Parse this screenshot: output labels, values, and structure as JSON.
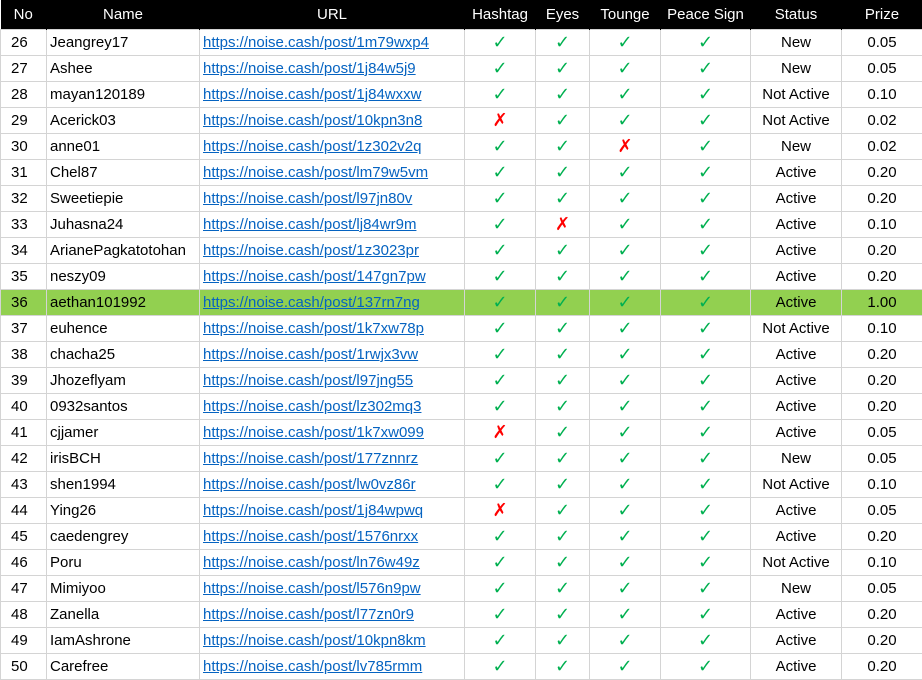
{
  "colors": {
    "header_bg": "#000000",
    "header_text": "#ffffff",
    "link": "#0563c1",
    "check": "#00b050",
    "cross": "#ff0000",
    "highlight": "#92d050"
  },
  "icons": {
    "yes": "check-icon",
    "no": "cross-icon"
  },
  "headers": [
    "No",
    "Name",
    "URL",
    "Hashtag",
    "Eyes",
    "Tounge",
    "Peace Sign",
    "Status",
    "Prize"
  ],
  "rows": [
    {
      "no": "26",
      "name": "Jeangrey17",
      "url": "https://noise.cash/post/1m79wxp4",
      "hashtag": true,
      "eyes": true,
      "tounge": true,
      "peace": true,
      "status": "New",
      "prize": "0.05"
    },
    {
      "no": "27",
      "name": "Ashee",
      "url": "https://noise.cash/post/1j84w5j9",
      "hashtag": true,
      "eyes": true,
      "tounge": true,
      "peace": true,
      "status": "New",
      "prize": "0.05"
    },
    {
      "no": "28",
      "name": "mayan120189",
      "url": "https://noise.cash/post/1j84wxxw",
      "hashtag": true,
      "eyes": true,
      "tounge": true,
      "peace": true,
      "status": "Not Active",
      "prize": "0.10"
    },
    {
      "no": "29",
      "name": "Acerick03",
      "url": "https://noise.cash/post/10kpn3n8",
      "hashtag": false,
      "eyes": true,
      "tounge": true,
      "peace": true,
      "status": "Not Active",
      "prize": "0.02"
    },
    {
      "no": "30",
      "name": "anne01",
      "url": "https://noise.cash/post/1z302v2q",
      "hashtag": true,
      "eyes": true,
      "tounge": false,
      "peace": true,
      "status": "New",
      "prize": "0.02"
    },
    {
      "no": "31",
      "name": "Chel87",
      "url": "https://noise.cash/post/lm79w5vm",
      "hashtag": true,
      "eyes": true,
      "tounge": true,
      "peace": true,
      "status": "Active",
      "prize": "0.20"
    },
    {
      "no": "32",
      "name": "Sweetiepie",
      "url": "https://noise.cash/post/l97jn80v",
      "hashtag": true,
      "eyes": true,
      "tounge": true,
      "peace": true,
      "status": "Active",
      "prize": "0.20"
    },
    {
      "no": "33",
      "name": "Juhasna24",
      "url": "https://noise.cash/post/lj84wr9m",
      "hashtag": true,
      "eyes": false,
      "tounge": true,
      "peace": true,
      "status": "Active",
      "prize": "0.10"
    },
    {
      "no": "34",
      "name": "ArianePagkatotohan",
      "url": "https://noise.cash/post/1z3023pr",
      "hashtag": true,
      "eyes": true,
      "tounge": true,
      "peace": true,
      "status": "Active",
      "prize": "0.20"
    },
    {
      "no": "35",
      "name": "neszy09",
      "url": "https://noise.cash/post/147gn7pw",
      "hashtag": true,
      "eyes": true,
      "tounge": true,
      "peace": true,
      "status": "Active",
      "prize": "0.20"
    },
    {
      "no": "36",
      "name": "aethan101992",
      "url": "https://noise.cash/post/137rn7ng",
      "hashtag": true,
      "eyes": true,
      "tounge": true,
      "peace": true,
      "status": "Active",
      "prize": "1.00",
      "highlight": true
    },
    {
      "no": "37",
      "name": "euhence",
      "url": "https://noise.cash/post/1k7xw78p",
      "hashtag": true,
      "eyes": true,
      "tounge": true,
      "peace": true,
      "status": "Not Active",
      "prize": "0.10"
    },
    {
      "no": "38",
      "name": "chacha25",
      "url": "https://noise.cash/post/1rwjx3vw",
      "hashtag": true,
      "eyes": true,
      "tounge": true,
      "peace": true,
      "status": "Active",
      "prize": "0.20"
    },
    {
      "no": "39",
      "name": "Jhozeflyam",
      "url": "https://noise.cash/post/l97jng55",
      "hashtag": true,
      "eyes": true,
      "tounge": true,
      "peace": true,
      "status": "Active",
      "prize": "0.20"
    },
    {
      "no": "40",
      "name": "0932santos",
      "url": "https://noise.cash/post/lz302mq3",
      "hashtag": true,
      "eyes": true,
      "tounge": true,
      "peace": true,
      "status": "Active",
      "prize": "0.20"
    },
    {
      "no": "41",
      "name": "cjjamer",
      "url": "https://noise.cash/post/1k7xw099",
      "hashtag": false,
      "eyes": true,
      "tounge": true,
      "peace": true,
      "status": "Active",
      "prize": "0.05"
    },
    {
      "no": "42",
      "name": "irisBCH",
      "url": "https://noise.cash/post/177znnrz",
      "hashtag": true,
      "eyes": true,
      "tounge": true,
      "peace": true,
      "status": "New",
      "prize": "0.05"
    },
    {
      "no": "43",
      "name": "shen1994",
      "url": "https://noise.cash/post/lw0vz86r",
      "hashtag": true,
      "eyes": true,
      "tounge": true,
      "peace": true,
      "status": "Not Active",
      "prize": "0.10"
    },
    {
      "no": "44",
      "name": "Ying26",
      "url": "https://noise.cash/post/1j84wpwq",
      "hashtag": false,
      "eyes": true,
      "tounge": true,
      "peace": true,
      "status": "Active",
      "prize": "0.05"
    },
    {
      "no": "45",
      "name": "caedengrey",
      "url": "https://noise.cash/post/1576nrxx",
      "hashtag": true,
      "eyes": true,
      "tounge": true,
      "peace": true,
      "status": "Active",
      "prize": "0.20"
    },
    {
      "no": "46",
      "name": "Poru",
      "url": "https://noise.cash/post/ln76w49z",
      "hashtag": true,
      "eyes": true,
      "tounge": true,
      "peace": true,
      "status": "Not Active",
      "prize": "0.10"
    },
    {
      "no": "47",
      "name": "Mimiyoo",
      "url": "https://noise.cash/post/l576n9pw",
      "hashtag": true,
      "eyes": true,
      "tounge": true,
      "peace": true,
      "status": "New",
      "prize": "0.05"
    },
    {
      "no": "48",
      "name": "Zanella",
      "url": "https://noise.cash/post/l77zn0r9",
      "hashtag": true,
      "eyes": true,
      "tounge": true,
      "peace": true,
      "status": "Active",
      "prize": "0.20"
    },
    {
      "no": "49",
      "name": "IamAshrone",
      "url": "https://noise.cash/post/10kpn8km",
      "hashtag": true,
      "eyes": true,
      "tounge": true,
      "peace": true,
      "status": "Active",
      "prize": "0.20"
    },
    {
      "no": "50",
      "name": "Carefree",
      "url": "https://noise.cash/post/lv785rmm",
      "hashtag": true,
      "eyes": true,
      "tounge": true,
      "peace": true,
      "status": "Active",
      "prize": "0.20"
    }
  ]
}
